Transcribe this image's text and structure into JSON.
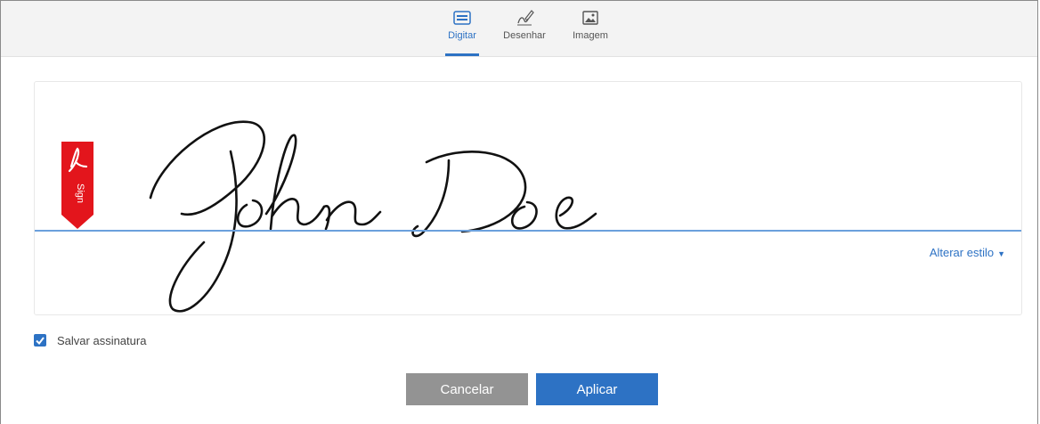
{
  "tabs": [
    {
      "label": "Digitar",
      "icon": "keyboard-icon",
      "active": true
    },
    {
      "label": "Desenhar",
      "icon": "pen-draw-icon",
      "active": false
    },
    {
      "label": "Imagem",
      "icon": "image-icon",
      "active": false
    }
  ],
  "signature": {
    "text": "John Doe",
    "bookmark_text": "Sign",
    "change_style_label": "Alterar estilo",
    "change_style_icon": "caret-down-icon"
  },
  "save_signature": {
    "label": "Salvar assinatura",
    "checked": true
  },
  "buttons": {
    "cancel": "Cancelar",
    "apply": "Aplicar"
  },
  "colors": {
    "accent": "#2d72c4",
    "cancel_bg": "#939393",
    "adobe_red": "#e3151c",
    "baseline": "#6ba0dc"
  }
}
